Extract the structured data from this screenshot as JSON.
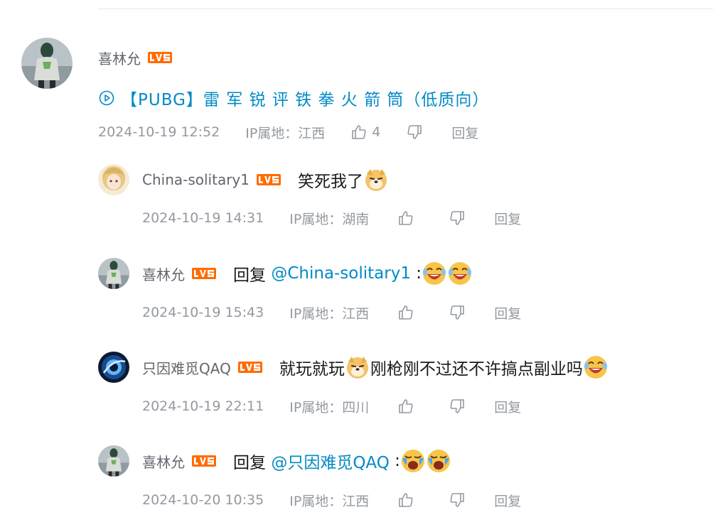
{
  "colors": {
    "link": "#008ac5",
    "meta": "#9499a0",
    "username": "#61666d",
    "text": "#18191c",
    "level_badge": "#ff6c00"
  },
  "root": {
    "username": "喜林允",
    "level": "LV5",
    "video_link_text": "【PUBG】雷 军 锐 评 铁 拳 火 箭 筒（低质向）",
    "time": "2024-10-19 12:52",
    "ip": "IP属地：江西",
    "like_count": "4",
    "reply_label": "回复"
  },
  "replies": [
    {
      "username": "China-solitary1",
      "level": "LV5",
      "text_before": "笑死我了",
      "emojis_after": [
        "doge-emoji"
      ],
      "time": "2024-10-19 14:31",
      "ip": "IP属地：湖南",
      "reply_label": "回复"
    },
    {
      "username": "喜林允",
      "level": "LV5",
      "reply_prefix": "回复 ",
      "mention": "@China-solitary1",
      "colon": " :",
      "emojis_after": [
        "laugh-tears-emoji",
        "laugh-tears-emoji"
      ],
      "time": "2024-10-19 15:43",
      "ip": "IP属地：江西",
      "reply_label": "回复"
    },
    {
      "username": "只因难觅QAQ",
      "level": "LV5",
      "text_part1": "就玩就玩",
      "text_part2": "刚枪刚不过还不许搞点副业吗",
      "emojis": [
        "doge-emoji",
        "laugh-tears-emoji"
      ],
      "time": "2024-10-19 22:11",
      "ip": "IP属地：四川",
      "reply_label": "回复"
    },
    {
      "username": "喜林允",
      "level": "LV5",
      "reply_prefix": "回复 ",
      "mention": "@只因难觅QAQ",
      "colon": " :",
      "emojis_after": [
        "cry-laugh-emoji",
        "cry-laugh-emoji"
      ],
      "time": "2024-10-20 10:35",
      "ip": "IP属地：江西",
      "reply_label": "回复"
    }
  ]
}
